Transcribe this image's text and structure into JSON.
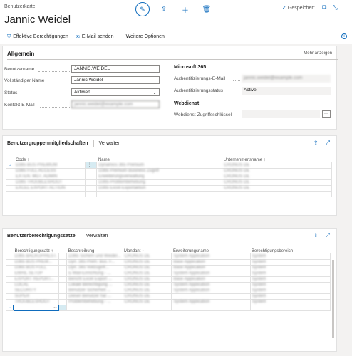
{
  "header": {
    "breadcrumb": "Benutzerkarte",
    "title": "Jannic Weidel",
    "saved_label": "Gespeichert"
  },
  "actionbar": {
    "items": [
      "Effektive Berechtigungen",
      "E-Mail senden",
      "Weitere Optionen"
    ]
  },
  "general": {
    "title": "Allgemein",
    "more": "Mehr anzeigen",
    "fields": {
      "username_label": "Benutzername",
      "username_value": "JANNIC.WEIDEL",
      "fullname_label": "Vollständiger Name",
      "fullname_value": "Jannic Weidel",
      "status_label": "Status",
      "status_value": "Aktiviert",
      "email_label": "Kontakt-E-Mail",
      "email_value": "jannic.weidel@example.com"
    },
    "ms365": {
      "heading": "Microsoft 365",
      "auth_email_label": "Authentifizierungs-E-Mail",
      "auth_email_value": "jannic.weidel@example.com",
      "auth_status_label": "Authentifizierungsstatus",
      "auth_status_value": "Active"
    },
    "webservice": {
      "heading": "Webdienst",
      "key_label": "Webdienst-Zugriffsschlüssel",
      "key_value": "",
      "assist": "···"
    }
  },
  "groups": {
    "title": "Benutzergruppenmitgliedschaften",
    "manage": "Verwalten",
    "columns": [
      "Code ↑",
      "Name",
      "Unternehmensname ↑"
    ],
    "rows": [
      [
        "D365 BUS PREMIUM",
        "Dynamics 365 Premium",
        "CRONUS DE"
      ],
      [
        "D365 FULL ACCESS",
        "D365 Premium Business Zugriff",
        "CRONUS DE"
      ],
      [
        "EXTEN. MGT. ADMIN",
        "Erweiterungsverwaltung",
        "CRONUS DE"
      ],
      [
        "D365 TROUBLESHOOT",
        "D365-Problembehebung",
        "CRONUS DE"
      ],
      [
        "EXCEL EXPORT ACTION",
        "D365 Excel-Exportaktion",
        "CRONUS DE"
      ]
    ]
  },
  "permissions": {
    "title": "Benutzerberechtigungssätze",
    "manage": "Verwalten",
    "columns": [
      "Berechtigungssatz ↑",
      "Beschreibung",
      "Mandant ↑",
      "Erweiterungsname",
      "Berechtigungsbereich"
    ],
    "rows": [
      [
        "D365 BACKUP/REST.",
        "D365 Sichern und Wieder...",
        "CRONUS DE",
        "System Application",
        "System"
      ],
      [
        "D365 BUS PREM...",
        "Dyn. 365 Prem. Bus. F...",
        "CRONUS DE",
        "Base Application",
        "System"
      ],
      [
        "D365 BUS FULL",
        "Dyn. 365 Vollzugriff...",
        "CRONUS DE",
        "Base Application",
        "System"
      ],
      [
        "EMAIL SETUP",
        "E-Mail-Einrichtung - ...",
        "CRONUS DE",
        "System Application",
        "System"
      ],
      [
        "EXPORT REPORT...",
        "Bericht Excel Export ...",
        "CRONUS DE",
        "Base Application",
        "System"
      ],
      [
        "LOCAL",
        "Lokale Berechtigung ...",
        "CRONUS DE",
        "System Application",
        "System"
      ],
      [
        "SECURITY",
        "Benutzer Sicherheit ...",
        "CRONUS DE",
        "System Application",
        "System"
      ],
      [
        "SUPER",
        "Dieser Benutzer hat ...",
        "CRONUS DE",
        "",
        "System"
      ],
      [
        "TROUBLESHOOT",
        "Problembehebung - ...",
        "CRONUS DE",
        "System Application",
        "System"
      ]
    ],
    "new_row_assist": "···"
  }
}
